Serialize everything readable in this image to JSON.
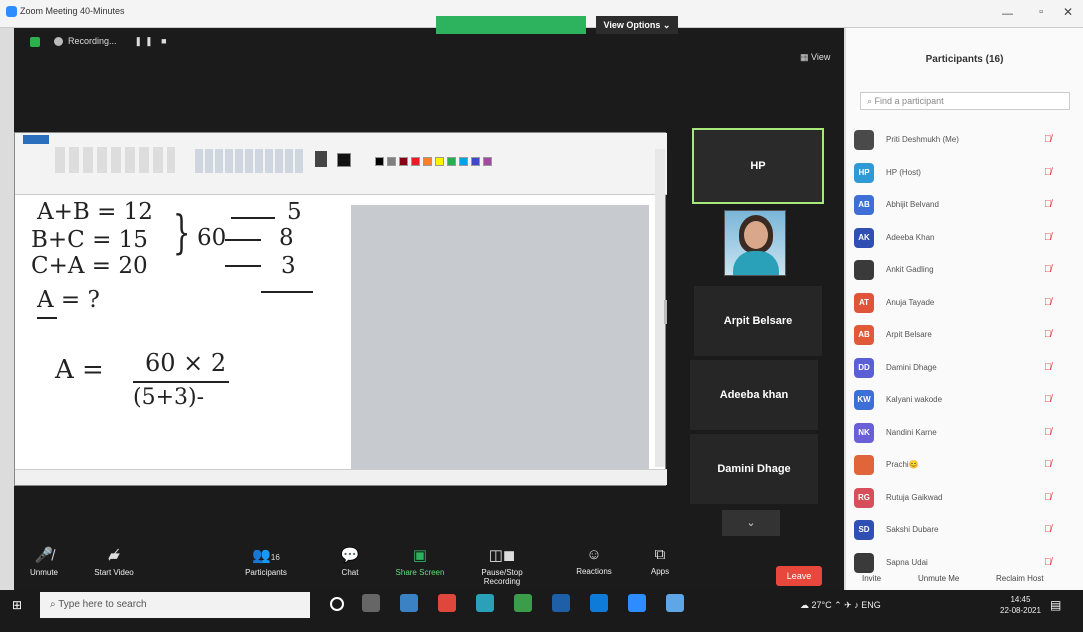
{
  "window": {
    "title": "Zoom Meeting 40-Minutes"
  },
  "share_banner": "",
  "view_options": "View Options ⌄",
  "recording": {
    "label": "Recording..."
  },
  "view_btn": "View",
  "whiteboard": {
    "line1": "A+B = 12",
    "line2": "B+C = 15",
    "line3": "C+A = 20",
    "brace_total": "60",
    "r1": "5",
    "r2": "8",
    "r3": "3",
    "ask": "A = ?",
    "result_lhs": "A =",
    "result_num": "60 × 2",
    "result_den": "(5+3)-"
  },
  "videos": {
    "hp": "HP",
    "t1": "Arpit Belsare",
    "t2": "Adeeba khan",
    "t3": "Damini Dhage"
  },
  "toolbar": {
    "unmute": "Unmute",
    "start_video": "Start Video",
    "participants": "Participants",
    "participants_count": "16",
    "chat": "Chat",
    "share": "Share Screen",
    "pause_rec": "Pause/Stop Recording",
    "reactions": "Reactions",
    "apps": "Apps",
    "end": "Leave"
  },
  "panel": {
    "title": "Participants (16)",
    "search_placeholder": "Find a participant",
    "people": [
      {
        "initials": "",
        "name": "Priti Deshmukh (Me)",
        "color": "#4a4a4a"
      },
      {
        "initials": "HP",
        "name": "HP (Host)",
        "color": "#2e9bd6"
      },
      {
        "initials": "AB",
        "name": "Abhijit Belvand",
        "color": "#3d6fd6"
      },
      {
        "initials": "AK",
        "name": "Adeeba Khan",
        "color": "#2f4fb3"
      },
      {
        "initials": "",
        "name": "Ankit Gadling",
        "color": "#3a3a3a"
      },
      {
        "initials": "AT",
        "name": "Anuja Tayade",
        "color": "#e0553a"
      },
      {
        "initials": "AB",
        "name": "Arpit Belsare",
        "color": "#e05a3a"
      },
      {
        "initials": "DD",
        "name": "Damini Dhage",
        "color": "#5b5fd6"
      },
      {
        "initials": "KW",
        "name": "Kalyani wakode",
        "color": "#3d6fd6"
      },
      {
        "initials": "NK",
        "name": "Nandini Karne",
        "color": "#6a5fd6"
      },
      {
        "initials": "",
        "name": "Prachi😊",
        "color": "#e0653a"
      },
      {
        "initials": "RG",
        "name": "Rutuja Gaikwad",
        "color": "#d64f5a"
      },
      {
        "initials": "SD",
        "name": "Sakshi Dubare",
        "color": "#2f4fb3"
      },
      {
        "initials": "",
        "name": "Sapna Udai",
        "color": "#3a3a3a"
      }
    ],
    "footer": {
      "invite": "Invite",
      "mute_me": "Unmute Me",
      "reclaim": "Reclaim Host"
    }
  },
  "taskbar": {
    "search": "Type here to search",
    "temp": "27°C",
    "lang": "ENG",
    "time": "14:45",
    "date": "22-08-2021"
  }
}
